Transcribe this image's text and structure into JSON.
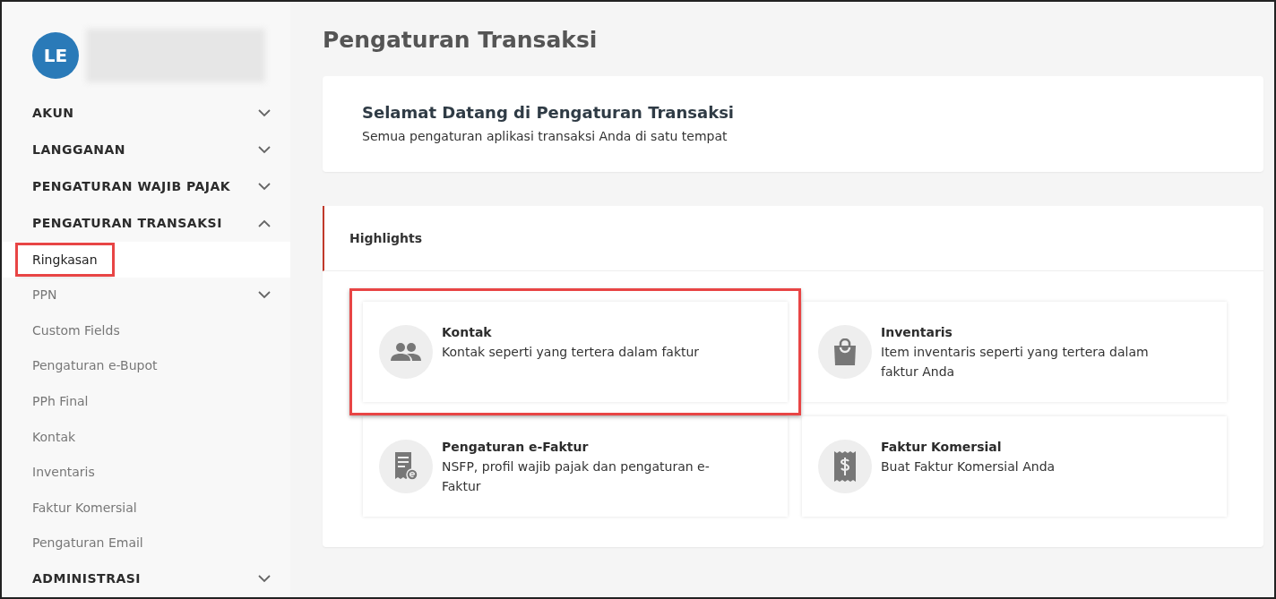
{
  "user": {
    "initials": "LE"
  },
  "sidebar": {
    "items": [
      {
        "label": "AKUN",
        "kind": "section",
        "expanded": false
      },
      {
        "label": "LANGGANAN",
        "kind": "section",
        "expanded": false
      },
      {
        "label": "PENGATURAN WAJIB PAJAK",
        "kind": "section",
        "expanded": false
      },
      {
        "label": "PENGATURAN TRANSAKSI",
        "kind": "section",
        "expanded": true,
        "children": [
          {
            "label": "Ringkasan",
            "selected": true,
            "highlighted": true
          },
          {
            "label": "PPN",
            "selected": false,
            "highlighted": false,
            "expandable": true
          },
          {
            "label": "Custom Fields",
            "selected": false,
            "highlighted": false
          },
          {
            "label": "Pengaturan e-Bupot",
            "selected": false,
            "highlighted": false
          },
          {
            "label": "PPh Final",
            "selected": false,
            "highlighted": false
          },
          {
            "label": "Kontak",
            "selected": false,
            "highlighted": false
          },
          {
            "label": "Inventaris",
            "selected": false,
            "highlighted": false
          },
          {
            "label": "Faktur Komersial",
            "selected": false,
            "highlighted": false
          },
          {
            "label": "Pengaturan Email",
            "selected": false,
            "highlighted": false
          }
        ]
      },
      {
        "label": "ADMINISTRASI",
        "kind": "section",
        "expanded": false
      }
    ]
  },
  "page_title": "Pengaturan Transaksi",
  "welcome": {
    "title": "Selamat Datang di Pengaturan Transaksi",
    "subtitle": "Semua pengaturan aplikasi transaksi Anda di satu tempat"
  },
  "highlights": {
    "title": "Highlights",
    "cards": [
      {
        "kind": "contacts",
        "title": "Kontak",
        "description": "Kontak seperti yang tertera dalam faktur",
        "highlighted": true
      },
      {
        "kind": "inventory",
        "title": "Inventaris",
        "description": "Item inventaris seperti yang tertera dalam faktur Anda",
        "highlighted": false
      },
      {
        "kind": "efaktur",
        "title": "Pengaturan e-Faktur",
        "description": "NSFP, profil wajib pajak dan pengaturan e-Faktur",
        "highlighted": false
      },
      {
        "kind": "commercial",
        "title": "Faktur Komersial",
        "description": "Buat Faktur Komersial Anda",
        "highlighted": false
      }
    ]
  }
}
